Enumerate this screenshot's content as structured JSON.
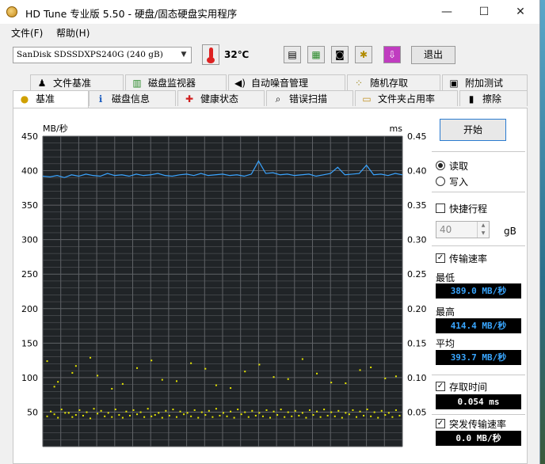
{
  "window": {
    "title": "HD Tune 专业版 5.50 - 硬盘/固态硬盘实用程序",
    "minimize": "—",
    "maximize": "☐",
    "close": "✕"
  },
  "menu": {
    "file": "文件(F)",
    "help": "帮助(H)"
  },
  "toolbar": {
    "drive": "SanDisk SDSSDXPS240G (240 gB)",
    "temperature": "32℃",
    "exit": "退出"
  },
  "tabs": {
    "row1": [
      "文件基准",
      "磁盘监视器",
      "自动噪音管理",
      "随机存取",
      "附加测试"
    ],
    "row2": [
      "基准",
      "磁盘信息",
      "健康状态",
      "错误扫描",
      "文件夹占用率",
      "擦除"
    ]
  },
  "side": {
    "start": "开始",
    "read": "读取",
    "write": "写入",
    "quick": "快捷行程",
    "quick_value": "40",
    "quick_unit": "gB",
    "transfer_rate": "传输速率",
    "min_label": "最低",
    "min_value": "389.0 MB/秒",
    "max_label": "最高",
    "max_value": "414.4 MB/秒",
    "avg_label": "平均",
    "avg_value": "393.7 MB/秒",
    "access_time": "存取时间",
    "access_value": "0.054 ms",
    "burst": "突发传输速率",
    "burst_value": "0.0 MB/秒"
  },
  "colors": {
    "line": "#3aa4ff",
    "dots": "#e6e600",
    "grid": "#5f6266",
    "plot_bg": "#202427",
    "readout": "#39a6ff"
  },
  "chart_data": {
    "type": "line",
    "ylabel": "MB/秒",
    "y2label": "ms",
    "ylim": [
      0,
      450
    ],
    "y2lim": [
      0,
      0.45
    ],
    "yticks": [
      50,
      100,
      150,
      200,
      250,
      300,
      350,
      400,
      450
    ],
    "y2ticks": [
      "0.05",
      "0.10",
      "0.15",
      "0.20",
      "0.25",
      "0.30",
      "0.35",
      "0.40",
      "0.45"
    ],
    "grid": true,
    "series": [
      {
        "kind": "transfer-rate-line",
        "x": [
          0,
          2,
          4,
          6,
          8,
          10,
          12,
          14,
          16,
          18,
          20,
          22,
          24,
          26,
          28,
          30,
          32,
          34,
          36,
          38,
          40,
          42,
          44,
          46,
          48,
          50,
          52,
          54,
          56,
          58,
          60,
          62,
          64,
          66,
          68,
          70,
          72,
          74,
          76,
          78,
          80,
          82,
          84,
          86,
          88,
          90,
          92,
          94,
          96,
          98,
          100
        ],
        "values": [
          392,
          391,
          393,
          390,
          394,
          392,
          395,
          393,
          392,
          396,
          393,
          394,
          392,
          395,
          393,
          394,
          396,
          393,
          392,
          394,
          395,
          393,
          396,
          393,
          394,
          395,
          393,
          394,
          392,
          395,
          414,
          396,
          397,
          394,
          395,
          393,
          394,
          395,
          392,
          394,
          396,
          405,
          394,
          395,
          396,
          408,
          394,
          395,
          393,
          396,
          394
        ]
      },
      {
        "kind": "access-time-scatter",
        "x": [
          1,
          3,
          4,
          6,
          8,
          9,
          11,
          13,
          15,
          17,
          19,
          21,
          22,
          24,
          26,
          28,
          30,
          31,
          33,
          35,
          37,
          39,
          41,
          43,
          45,
          47,
          49,
          51,
          53,
          55,
          57,
          59,
          61,
          63,
          65,
          67,
          69,
          71,
          73,
          75,
          77,
          79,
          81,
          83,
          85,
          87,
          89,
          91,
          93,
          95,
          97,
          99,
          2,
          5,
          7,
          10,
          12,
          14,
          16,
          18,
          20,
          23,
          25,
          27,
          29,
          32,
          34,
          36,
          38,
          40,
          42,
          44,
          46,
          48,
          50,
          52,
          54,
          56,
          58,
          60,
          62,
          64,
          66,
          68,
          70,
          72,
          74,
          76,
          78,
          80,
          82,
          84,
          86,
          88,
          90,
          92,
          94,
          96,
          98,
          1,
          4,
          8,
          13,
          19,
          26,
          33,
          41,
          48,
          56,
          64,
          72,
          80,
          88,
          95,
          3,
          9,
          15,
          22,
          30,
          37,
          45,
          52,
          60,
          68,
          76,
          84,
          91,
          98
        ],
        "values": [
          0.045,
          0.048,
          0.043,
          0.05,
          0.044,
          0.047,
          0.046,
          0.042,
          0.049,
          0.045,
          0.044,
          0.047,
          0.043,
          0.046,
          0.048,
          0.044,
          0.045,
          0.047,
          0.043,
          0.046,
          0.044,
          0.048,
          0.045,
          0.043,
          0.047,
          0.044,
          0.046,
          0.045,
          0.043,
          0.048,
          0.044,
          0.046,
          0.045,
          0.043,
          0.047,
          0.044,
          0.045,
          0.046,
          0.043,
          0.047,
          0.044,
          0.046,
          0.045,
          0.043,
          0.048,
          0.044,
          0.046,
          0.045,
          0.043,
          0.047,
          0.044,
          0.046,
          0.052,
          0.055,
          0.05,
          0.054,
          0.051,
          0.056,
          0.053,
          0.05,
          0.055,
          0.052,
          0.054,
          0.051,
          0.056,
          0.05,
          0.053,
          0.055,
          0.052,
          0.05,
          0.054,
          0.051,
          0.053,
          0.056,
          0.05,
          0.052,
          0.055,
          0.051,
          0.053,
          0.05,
          0.054,
          0.052,
          0.055,
          0.051,
          0.053,
          0.05,
          0.054,
          0.052,
          0.055,
          0.051,
          0.053,
          0.05,
          0.054,
          0.052,
          0.055,
          0.051,
          0.053,
          0.05,
          0.054,
          0.125,
          0.095,
          0.108,
          0.13,
          0.085,
          0.115,
          0.098,
          0.122,
          0.09,
          0.11,
          0.102,
          0.128,
          0.094,
          0.112,
          0.1,
          0.088,
          0.118,
          0.104,
          0.092,
          0.126,
          0.096,
          0.114,
          0.086,
          0.12,
          0.099,
          0.107,
          0.093,
          0.116,
          0.103
        ]
      }
    ]
  }
}
